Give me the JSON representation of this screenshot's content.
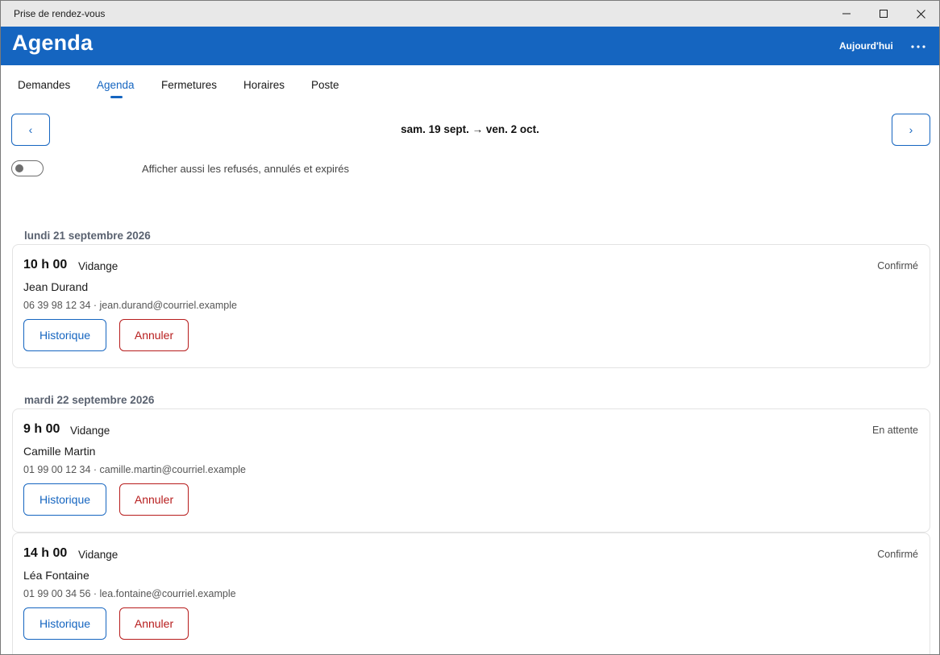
{
  "window": {
    "title": "Prise de rendez-vous",
    "controls": [
      "minimize-icon",
      "maximize-icon",
      "close-icon"
    ]
  },
  "appbar": {
    "title": "Agenda",
    "today_label": "Aujourd'hui",
    "more_icon": "more-horizontal-icon",
    "background": "#1565c0"
  },
  "tabs": [
    {
      "label": "Demandes",
      "active": false
    },
    {
      "label": "Agenda",
      "active": true
    },
    {
      "label": "Fermetures",
      "active": false
    },
    {
      "label": "Horaires",
      "active": false
    },
    {
      "label": "Poste",
      "active": false
    }
  ],
  "navigation": {
    "prev_label": "‹",
    "next_label": "›",
    "range": "sam. 19 sept. → ven. 2 oct."
  },
  "filter": {
    "label": "Afficher aussi les refusés, annulés et expirés",
    "enabled": false
  },
  "days": [
    {
      "header": "lundi 21 septembre 2026",
      "appointments": [
        {
          "time": "10 h 00",
          "service": "Vidange",
          "status": "Confirmé",
          "name": "Jean Durand",
          "contact": "06 39 98 12 34 · jean.durand@courriel.example",
          "history_label": "Historique",
          "cancel_label": "Annuler"
        }
      ]
    },
    {
      "header": "mardi 22 septembre 2026",
      "appointments": [
        {
          "time": "9 h 00",
          "service": "Vidange",
          "status": "En attente",
          "name": "Camille Martin",
          "contact": "01 99 00 12 34 · camille.martin@courriel.example",
          "history_label": "Historique",
          "cancel_label": "Annuler"
        },
        {
          "time": "14 h 00",
          "service": "Vidange",
          "status": "Confirmé",
          "name": "Léa Fontaine",
          "contact": "01 99 00 34 56 · lea.fontaine@courriel.example",
          "history_label": "Historique",
          "cancel_label": "Annuler"
        }
      ]
    }
  ],
  "colors": {
    "accent": "#1565c0",
    "danger": "#b71c1c",
    "day_header": "#5a6270"
  }
}
